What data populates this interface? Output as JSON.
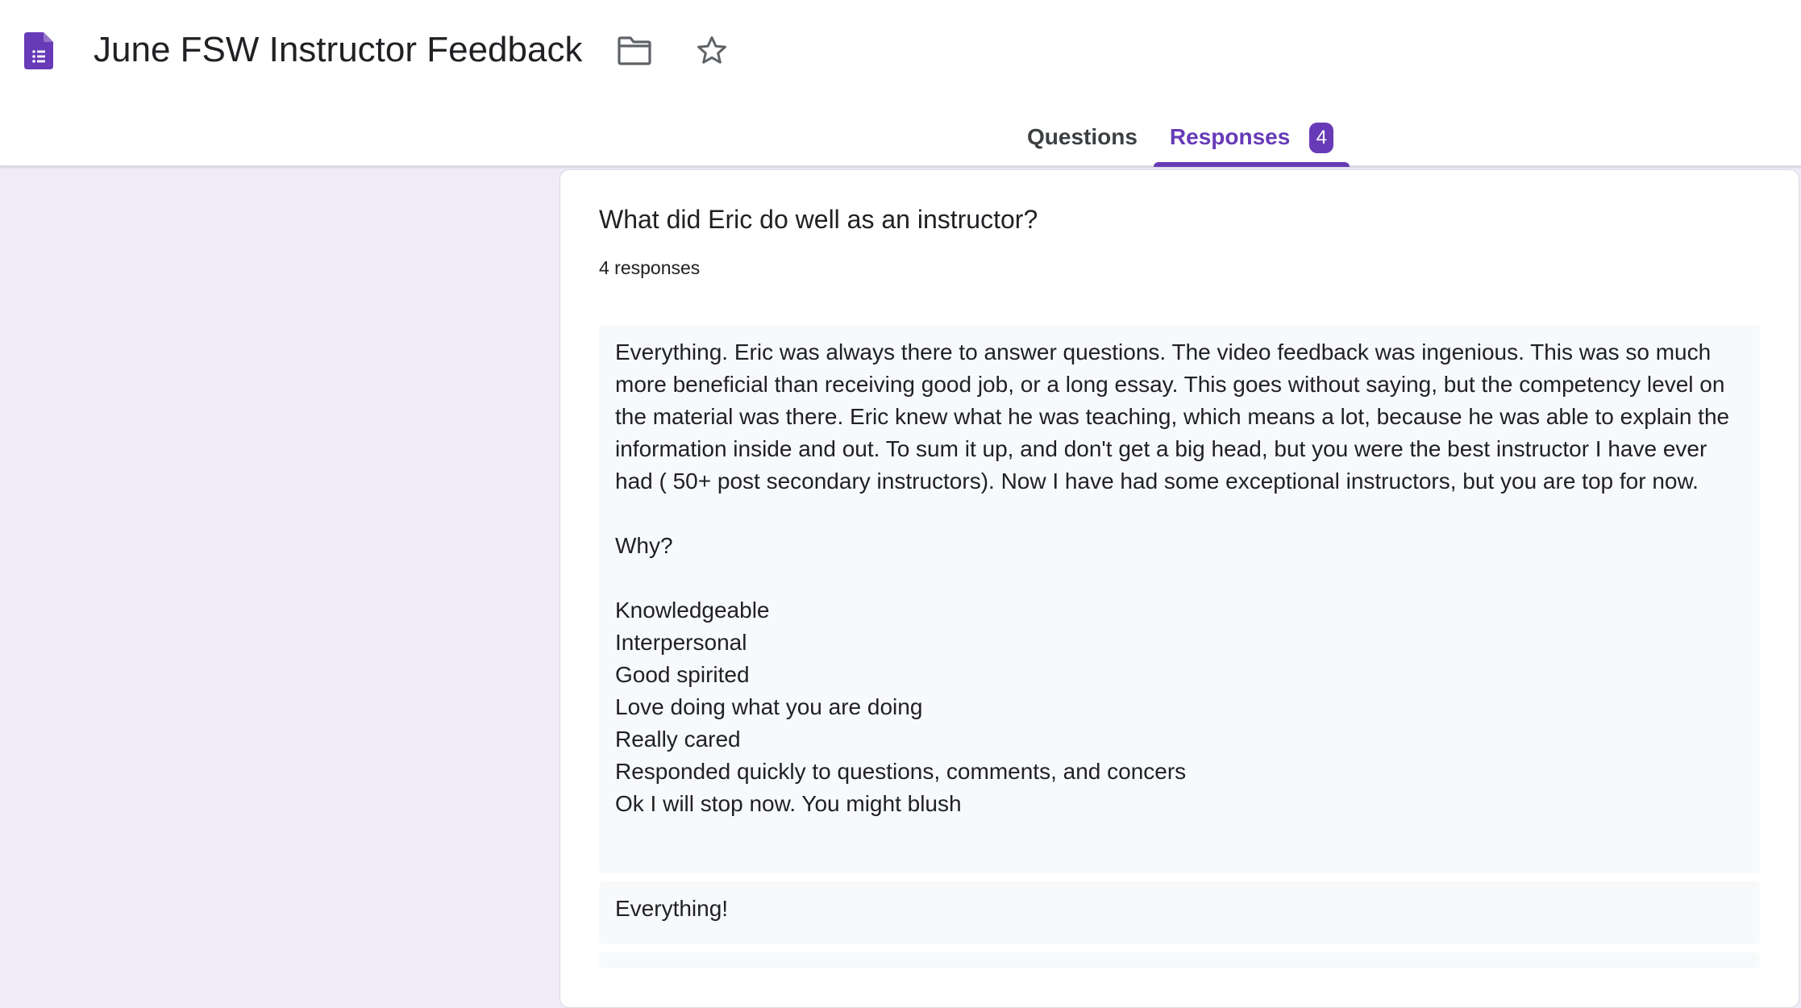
{
  "header": {
    "title": "June FSW Instructor Feedback",
    "app_icon": "google-forms-icon",
    "folder_icon": "folder-icon",
    "star_icon": "star-icon"
  },
  "tabs": [
    {
      "label": "Questions",
      "active": false
    },
    {
      "label": "Responses",
      "active": true,
      "badge": "4"
    }
  ],
  "question": {
    "title": "What did Eric do well as an instructor?",
    "count_label": "4 responses",
    "responses": [
      "Everything. Eric was always there to answer questions. The video feedback was ingenious. This was so much more beneficial than receiving good job, or a long essay. This goes without saying, but the competency level on the material was there. Eric knew what he was teaching, which means a lot, because he was able to explain the information inside and out. To sum it up, and don't get a big head, but you were the best instructor I have ever had ( 50+ post secondary instructors). Now I have had some exceptional instructors, but you are top for now.\n\nWhy?\n\nKnowledgeable\nInterpersonal\nGood spirited\nLove doing what you are doing\nReally cared\nResponded quickly to questions, comments, and concers\nOk I will stop now. You might blush",
      "Everything!"
    ]
  },
  "colors": {
    "accent": "#673ab7",
    "page_background": "#f0ebf8",
    "response_background": "#f8f9fa"
  }
}
